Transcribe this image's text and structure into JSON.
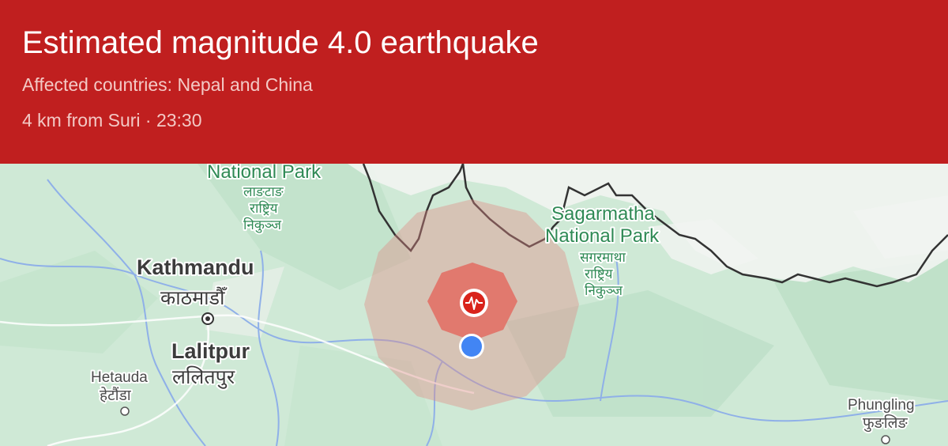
{
  "alert": {
    "title": "Estimated magnitude 4.0 earthquake",
    "affected": "Affected countries: Nepal and China",
    "location_time": "4 km from Suri · 23:30",
    "accent_color": "#c01f1f"
  },
  "map": {
    "labels": {
      "langtang_en": "National Park",
      "langtang_np_1": "लाङटाङ",
      "langtang_np_2": "राष्ट्रिय",
      "langtang_np_3": "निकुञ्ज",
      "sagarmatha_en_1": "Sagarmatha",
      "sagarmatha_en_2": "National Park",
      "sagarmatha_np_1": "सगरमाथा",
      "sagarmatha_np_2": "राष्ट्रिय",
      "sagarmatha_np_3": "निकुञ्ज",
      "kathmandu_en": "Kathmandu",
      "kathmandu_np": "काठमाडौँ",
      "lalitpur_en": "Lalitpur",
      "lalitpur_np": "ललितपुर",
      "hetauda_en": "Hetauda",
      "hetauda_np": "हेटौंडा",
      "phungling_en": "Phungling",
      "phungling_np": "फुङलिङ"
    },
    "icons": {
      "epicenter": "seismograph-icon",
      "user_location": "blue-dot-icon",
      "city_marker": "city-dot-icon"
    },
    "colors": {
      "land": "#cfe9d6",
      "snow": "#f1f4f1",
      "border": "#333333",
      "outer_zone": "#e08a84",
      "inner_zone": "#e8483f",
      "epicenter": "#d9231b",
      "user_dot": "#4285f4"
    }
  }
}
